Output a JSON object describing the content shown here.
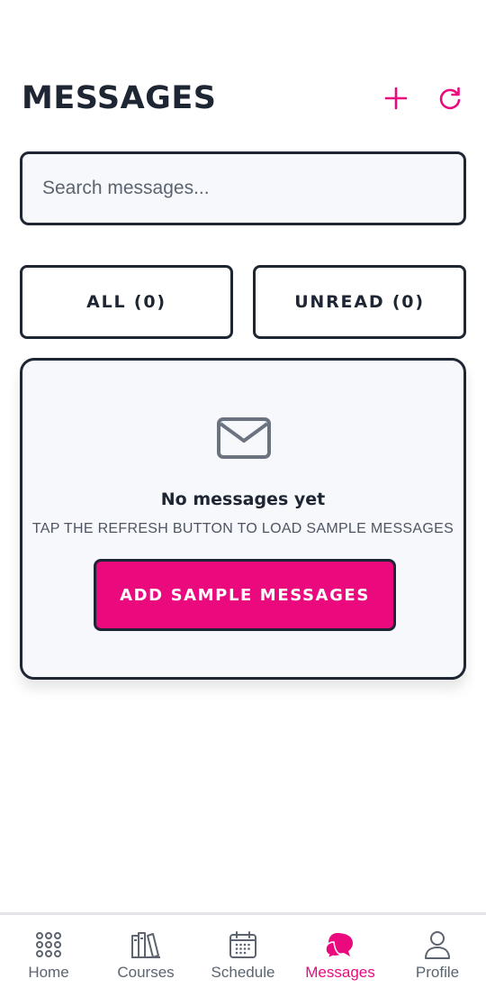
{
  "header": {
    "title": "MESSAGES",
    "add_icon": "plus-icon",
    "refresh_icon": "refresh-icon"
  },
  "search": {
    "placeholder": "Search messages...",
    "value": ""
  },
  "filters": [
    {
      "label": "ALL (0)",
      "count": 0
    },
    {
      "label": "UNREAD (0)",
      "count": 0
    }
  ],
  "empty_state": {
    "icon": "envelope-icon",
    "title": "No messages yet",
    "subtitle": "TAP THE REFRESH BUTTON TO LOAD SAMPLE MESSAGES",
    "button_label": "ADD SAMPLE MESSAGES"
  },
  "nav": {
    "items": [
      {
        "label": "Home",
        "icon": "grid-icon",
        "active": false
      },
      {
        "label": "Courses",
        "icon": "books-icon",
        "active": false
      },
      {
        "label": "Schedule",
        "icon": "calendar-icon",
        "active": false
      },
      {
        "label": "Messages",
        "icon": "chat-bubbles-icon",
        "active": true
      },
      {
        "label": "Profile",
        "icon": "user-icon",
        "active": false
      }
    ]
  },
  "colors": {
    "accent": "#ea0a7e",
    "text_dark": "#1e2533",
    "muted": "#5c6470",
    "card_bg": "#f7f8fb"
  }
}
